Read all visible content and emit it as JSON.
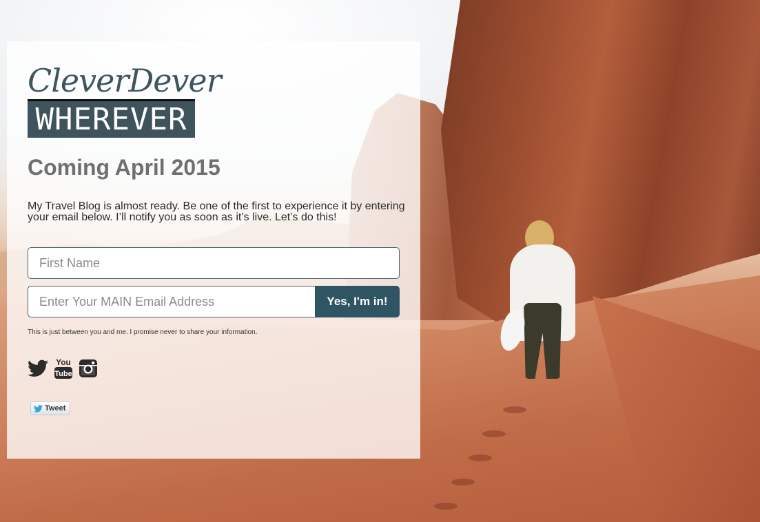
{
  "logo": {
    "line1": "CleverDever",
    "line2": "WHEREVER"
  },
  "heading": "Coming April 2015",
  "blurb": "My Travel Blog is almost ready. Be one of the first to experience it by entering your email below. I’ll notify you as soon as it’s live. Let’s do this!",
  "form": {
    "first_name_placeholder": "First Name",
    "email_placeholder": "Enter Your MAIN Email Address",
    "submit_label": "Yes, I'm in!"
  },
  "privacy_note": "This is just between you and me. I promise never to share your information.",
  "social": {
    "icons": [
      "twitter-icon",
      "youtube-icon",
      "instagram-icon"
    ],
    "youtube_text_top": "You",
    "youtube_text_bottom": "Tube"
  },
  "tweet_button": {
    "label": "Tweet"
  },
  "colors": {
    "brand": "#3e535c",
    "button": "#2f5564",
    "heading": "#6f6f6f"
  }
}
